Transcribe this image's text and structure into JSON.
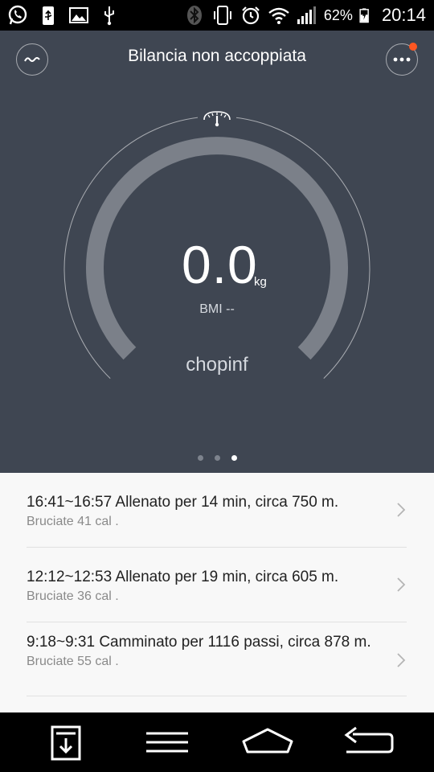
{
  "status_bar": {
    "battery": "62%",
    "time": "20:14",
    "icons": [
      "whatsapp-icon",
      "usb-icon",
      "image-icon",
      "usb-debug-icon",
      "bluetooth-icon",
      "vibrate-icon",
      "alarm-icon",
      "wifi-icon",
      "signal-icon",
      "battery-charging-icon"
    ]
  },
  "header": {
    "title": "Bilancia non accoppiata",
    "left_icon": "trend-icon",
    "right_icon": "more-icon",
    "notification_color": "#ff5722"
  },
  "gauge": {
    "weight": "0.0",
    "unit": "kg",
    "bmi": "BMI --",
    "username": "chopinf",
    "scale_icon": "scale-icon",
    "level": 0,
    "page_count": 3,
    "active_page": 3
  },
  "activities": [
    {
      "title": "16:41~16:57  Allenato per 14 min, circa 750 m.",
      "subtitle": "Bruciate 41 cal ."
    },
    {
      "title": "12:12~12:53  Allenato per 19 min, circa 605 m.",
      "subtitle": "Bruciate 36 cal ."
    },
    {
      "title": "9:18~9:31  Camminato per 1116 passi, circa 878 m.",
      "subtitle": "Bruciate 55 cal ."
    }
  ],
  "navbar": {
    "icons": [
      "download-icon",
      "menu-icon",
      "home-icon",
      "back-icon"
    ]
  },
  "colors": {
    "app_background": "#3f4652",
    "gauge_arc": "#7b8089",
    "list_background": "#f8f8f8"
  }
}
